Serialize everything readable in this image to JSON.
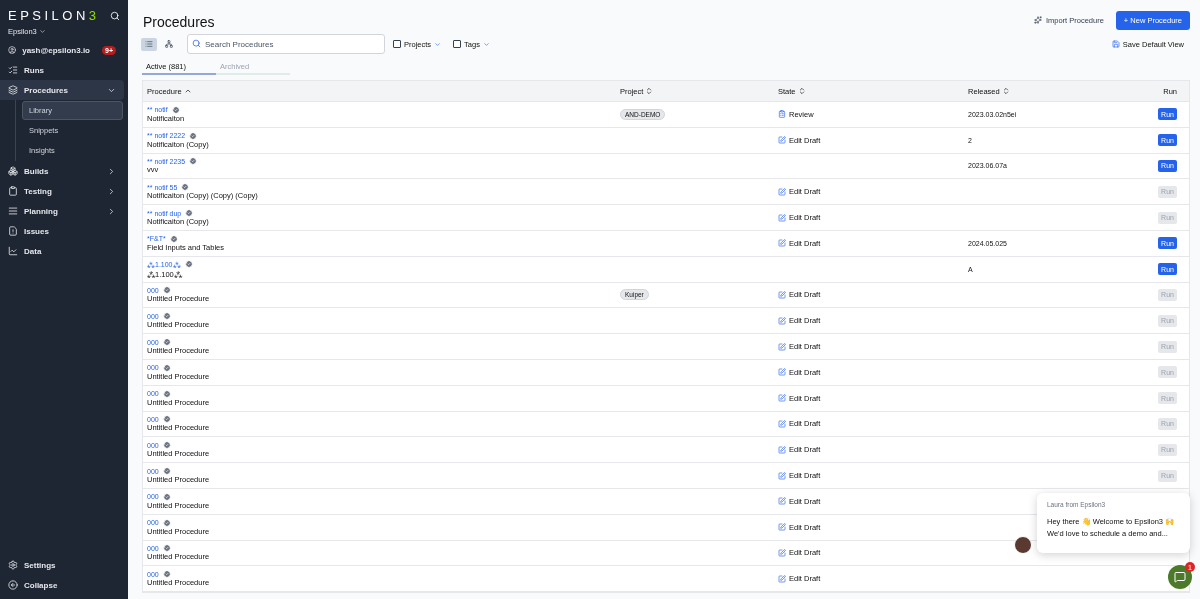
{
  "sidebar": {
    "logo": {
      "text": "EPSILON",
      "accent": "3"
    },
    "workspace": "Epsilon3",
    "user": {
      "email": "yash@epsilon3.io",
      "badge": "9+"
    },
    "items": [
      {
        "kind": "runs",
        "label": "Runs",
        "selected": false
      },
      {
        "kind": "procedures",
        "label": "Procedures",
        "selected": true,
        "expanded": true,
        "children": [
          {
            "label": "Library",
            "selected": true
          },
          {
            "label": "Snippets",
            "selected": false
          },
          {
            "label": "Insights",
            "selected": false
          }
        ]
      },
      {
        "kind": "builds",
        "label": "Builds",
        "selected": false,
        "expanded": false
      },
      {
        "kind": "testing",
        "label": "Testing",
        "selected": false,
        "expanded": false
      },
      {
        "kind": "planning",
        "label": "Planning",
        "selected": false,
        "expanded": false
      },
      {
        "kind": "issues",
        "label": "Issues",
        "selected": false
      },
      {
        "kind": "data",
        "label": "Data",
        "selected": false
      }
    ],
    "footer": [
      {
        "kind": "settings",
        "label": "Settings"
      },
      {
        "kind": "collapse",
        "label": "Collapse"
      }
    ]
  },
  "page": {
    "title": "Procedures",
    "import_button": "Import Procedure",
    "new_button": "+ New Procedure",
    "save_view": "Save Default View",
    "view_toggle": [
      {
        "kind": "list",
        "selected": true
      },
      {
        "kind": "tree",
        "selected": false
      }
    ],
    "search": {
      "placeholder": "Search Procedures"
    },
    "filters": [
      {
        "label": "Projects",
        "checked": false
      },
      {
        "label": "Tags",
        "checked": false
      }
    ],
    "tabs": [
      {
        "label": "Active (881)",
        "selected": true
      },
      {
        "label": "Archived",
        "selected": false
      }
    ]
  },
  "table": {
    "columns": [
      {
        "label": "Procedure",
        "sortable": true,
        "sorted": true
      },
      {
        "label": "Project",
        "sortable": true,
        "sorted": false
      },
      {
        "label": "State",
        "sortable": true,
        "sorted": false
      },
      {
        "label": "Released",
        "sortable": true,
        "sorted": false
      },
      {
        "label": "Run",
        "sortable": false
      }
    ],
    "rows": [
      {
        "key": "** notif",
        "name": "Notificaiton",
        "project": "AND-DEMO",
        "state": {
          "kind": "review",
          "label": "Review"
        },
        "released": "2023.03.02n5ei",
        "run": {
          "label": "Run",
          "disabled": false
        }
      },
      {
        "key": "** notif 2222",
        "name": "Notificaiton (Copy)",
        "state": {
          "kind": "edit",
          "label": "Edit Draft"
        },
        "released": "2",
        "run": {
          "label": "Run",
          "disabled": false
        }
      },
      {
        "key": "** notif 2235",
        "name": "vvv",
        "released": "2023.06.07a",
        "run": {
          "label": "Run",
          "disabled": false
        }
      },
      {
        "key": "** notif 55",
        "name": "Notificaiton (Copy) (Copy) (Copy)",
        "state": {
          "kind": "edit",
          "label": "Edit Draft"
        },
        "run": {
          "label": "Run",
          "disabled": true
        }
      },
      {
        "key": "** notif dup",
        "name": "Notificaiton (Copy)",
        "state": {
          "kind": "edit",
          "label": "Edit Draft"
        },
        "run": {
          "label": "Run",
          "disabled": true
        }
      },
      {
        "key": "*F&T*",
        "name": "Field Inputs and Tables",
        "state": {
          "kind": "edit",
          "label": "Edit Draft"
        },
        "released": "2024.05.025",
        "run": {
          "label": "Run",
          "disabled": false
        }
      },
      {
        "key": "⁂1.100⁂",
        "name": "⁂1.100⁂",
        "released": "A",
        "run": {
          "label": "Run",
          "disabled": false
        }
      },
      {
        "key": "000",
        "name": "Untitled Procedure",
        "project": "Kuiper",
        "state": {
          "kind": "edit",
          "label": "Edit Draft"
        },
        "run": {
          "label": "Run",
          "disabled": true
        }
      },
      {
        "key": "000",
        "name": "Untitled Procedure",
        "state": {
          "kind": "edit",
          "label": "Edit Draft"
        },
        "run": {
          "label": "Run",
          "disabled": true
        }
      },
      {
        "key": "000",
        "name": "Untitled Procedure",
        "state": {
          "kind": "edit",
          "label": "Edit Draft"
        },
        "run": {
          "label": "Run",
          "disabled": true
        }
      },
      {
        "key": "000",
        "name": "Untitled Procedure",
        "state": {
          "kind": "edit",
          "label": "Edit Draft"
        },
        "run": {
          "label": "Run",
          "disabled": true
        }
      },
      {
        "key": "000",
        "name": "Untitled Procedure",
        "state": {
          "kind": "edit",
          "label": "Edit Draft"
        },
        "run": {
          "label": "Run",
          "disabled": true
        }
      },
      {
        "key": "000",
        "name": "Untitled Procedure",
        "state": {
          "kind": "edit",
          "label": "Edit Draft"
        },
        "run": {
          "label": "Run",
          "disabled": true
        }
      },
      {
        "key": "000",
        "name": "Untitled Procedure",
        "state": {
          "kind": "edit",
          "label": "Edit Draft"
        },
        "run": {
          "label": "Run",
          "disabled": true
        }
      },
      {
        "key": "000",
        "name": "Untitled Procedure",
        "state": {
          "kind": "edit",
          "label": "Edit Draft"
        },
        "run": {
          "label": "Run",
          "disabled": true
        }
      },
      {
        "key": "000",
        "name": "Untitled Procedure",
        "state": {
          "kind": "edit",
          "label": "Edit Draft"
        }
      },
      {
        "key": "000",
        "name": "Untitled Procedure",
        "state": {
          "kind": "edit",
          "label": "Edit Draft"
        }
      },
      {
        "key": "000",
        "name": "Untitled Procedure",
        "state": {
          "kind": "edit",
          "label": "Edit Draft"
        }
      },
      {
        "key": "000",
        "name": "Untitled Procedure",
        "state": {
          "kind": "edit",
          "label": "Edit Draft"
        }
      }
    ]
  },
  "chat": {
    "sender": "Laura from Epsilon3",
    "lines": [
      "Hey there 👋 Welcome to Epsilon3 🙌",
      "We'd love to schedule a demo and..."
    ],
    "launcher_badge": "1"
  }
}
